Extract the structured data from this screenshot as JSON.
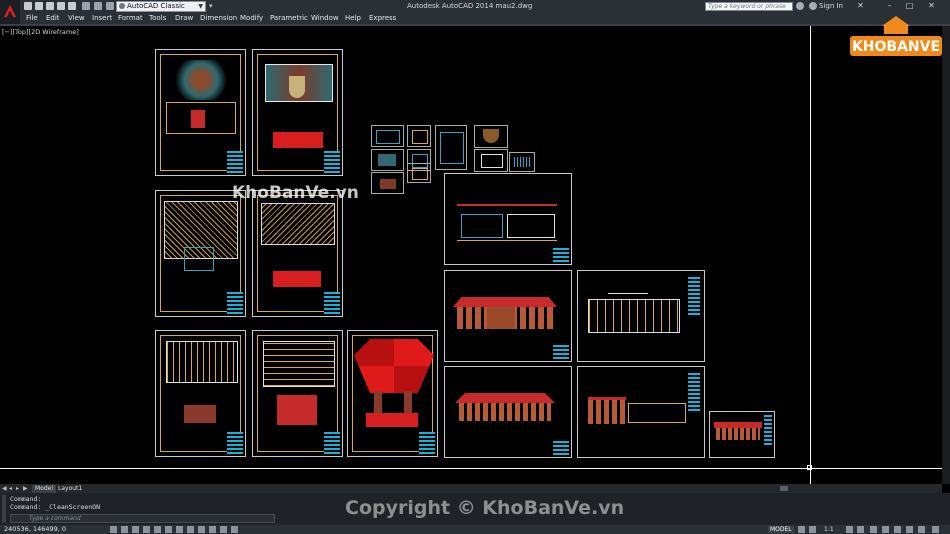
{
  "titlebar": {
    "workspace": "AutoCAD Classic",
    "title": "Autodesk AutoCAD 2014    mau2.dwg",
    "search_placeholder": "Type a keyword or phrase",
    "signin": "Sign In"
  },
  "menu": [
    "File",
    "Edit",
    "View",
    "Insert",
    "Format",
    "Tools",
    "Draw",
    "Dimension",
    "Modify",
    "Parametric",
    "Window",
    "Help",
    "Express"
  ],
  "viewport": {
    "label": "[−][Top][2D Wireframe]"
  },
  "watermark": {
    "logo": "KHOBANVE",
    "text_overlay": "KhoBanVe.vn",
    "copyright": "Copyright © KhoBanVe.vn"
  },
  "tabs": [
    "Model",
    "Layout1"
  ],
  "command": {
    "history": [
      "Command:",
      "Command: _CleanScreenON"
    ],
    "placeholder": "Type a command"
  },
  "status": {
    "coords": "240536, 146499, 0",
    "model_label": "MODEL",
    "scale": "1:1"
  }
}
